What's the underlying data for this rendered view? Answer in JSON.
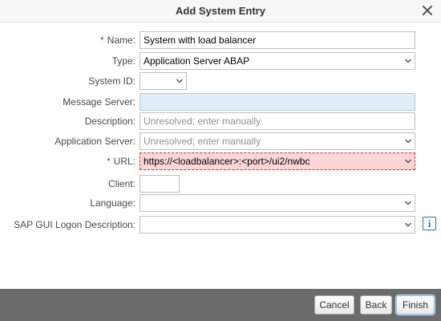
{
  "dialog": {
    "title": "Add System Entry"
  },
  "form": {
    "name": {
      "label": "Name:",
      "required_mark": "*",
      "value": "System with load balancer"
    },
    "type": {
      "label": "Type:",
      "value": "Application Server ABAP"
    },
    "system_id": {
      "label": "System ID:",
      "value": ""
    },
    "message_server": {
      "label": "Message Server:",
      "value": ""
    },
    "description": {
      "label": "Description:",
      "placeholder": "Unresolved; enter manually"
    },
    "application_server": {
      "label": "Application Server:",
      "placeholder": "Unresolved; enter manually"
    },
    "url": {
      "label": "URL:",
      "required_mark": "*",
      "value": "https://<loadbalancer>:<port>/ui2/nwbc"
    },
    "client": {
      "label": "Client:",
      "value": ""
    },
    "language": {
      "label": "Language:",
      "value": ""
    },
    "sap_gui_logon": {
      "label": "SAP GUI Logon Description:",
      "value": ""
    }
  },
  "buttons": {
    "cancel": "Cancel",
    "back": "Back",
    "finish": "Finish"
  },
  "colors": {
    "footer": "#6b6b6b",
    "error_bg": "#fbd6d6",
    "readonly_bg": "#e1edf8",
    "required_mark": "#1f6fbf"
  },
  "icons": {
    "close": "close-icon",
    "dropdown": "chevron-down-icon",
    "info": "info-icon"
  }
}
